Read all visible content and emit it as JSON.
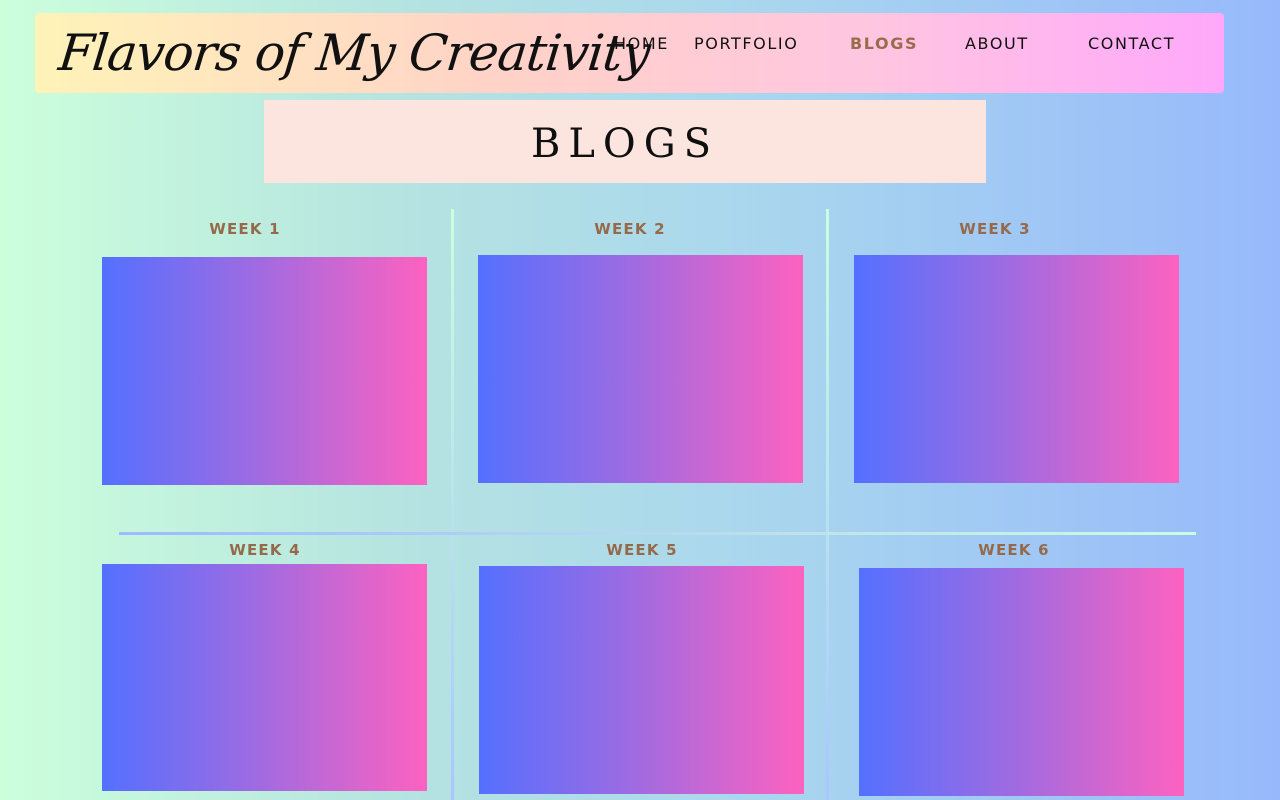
{
  "header": {
    "logo_text": "Flavors of My Creativity",
    "nav": [
      "HOME",
      "PORTFOLIO",
      "BLOGS",
      "ABOUT",
      "CONTACT"
    ],
    "active_nav": "BLOGS"
  },
  "page": {
    "title": "BLOGS"
  },
  "weeks": [
    {
      "label": "WEEK 1"
    },
    {
      "label": "WEEK 2"
    },
    {
      "label": "WEEK 3"
    },
    {
      "label": "WEEK 4"
    },
    {
      "label": "WEEK 5"
    },
    {
      "label": "WEEK 6"
    }
  ],
  "colors": {
    "accent_brown": "#956a4a",
    "card_gradient_start": "#5470ff",
    "card_gradient_end": "#fd62c0",
    "banner_bg": "#fbe5de"
  }
}
